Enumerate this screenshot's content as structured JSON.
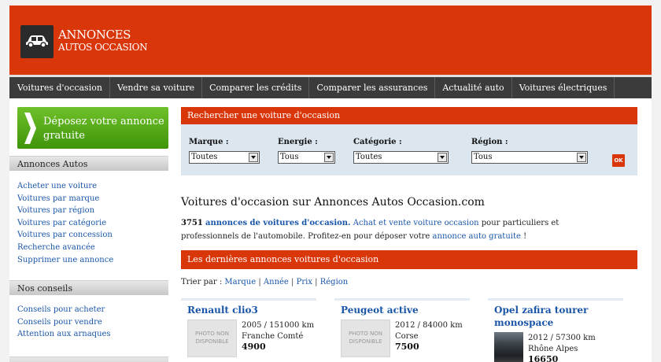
{
  "header": {
    "brand_line1": "ANNONCES",
    "brand_line2": "AUTOS OCCASION",
    "logo_icon": "car-icon"
  },
  "nav": {
    "items": [
      {
        "label": "Voitures d'occasion"
      },
      {
        "label": "Vendre sa voiture"
      },
      {
        "label": "Comparer les crédits"
      },
      {
        "label": "Comparer les assurances"
      },
      {
        "label": "Actualité auto"
      },
      {
        "label": "Voitures électriques"
      }
    ]
  },
  "sidebar": {
    "cta_line1": "Déposez votre annonce",
    "cta_line2": "gratuite",
    "cta_icon": "chevron-right-icon",
    "section1": {
      "title": "Annonces Autos",
      "links": [
        "Acheter une voiture",
        "Voitures par marque",
        "Voitures par région",
        "Voitures par catégorie",
        "Voitures par concession",
        "Recherche avancée",
        "Supprimer une annonce"
      ]
    },
    "section2": {
      "title": "Nos conseils",
      "links": [
        "Conseils pour acheter",
        "Conseils pour vendre",
        "Attention aux arnaques"
      ]
    }
  },
  "search": {
    "title": "Rechercher une voiture d'occasion",
    "marque_label": "Marque :",
    "marque_value": "Toutes",
    "energie_label": "Energie :",
    "energie_value": "Tous",
    "categorie_label": "Catégorie :",
    "categorie_value": "Toutes",
    "region_label": "Région :",
    "region_value": "Tous",
    "ok_label": "OK"
  },
  "main": {
    "title": "Voitures d'occasion sur Annonces Autos Occasion.com",
    "intro_count": "3751",
    "intro_link1": "annonces de voitures d'occasion.",
    "intro_link2": "Achat et vente voiture occasion",
    "intro_text1": "pour particuliers et professionnels de l'automobile. Profitez-en pour déposer votre",
    "intro_link3": "annonce auto gratuite",
    "intro_text2": "!",
    "ads_title": "Les dernières annonces voitures d'occasion",
    "sort_label": "Trier par :",
    "sort_options": [
      "Marque",
      "Année",
      "Prix",
      "Région"
    ]
  },
  "listings": [
    {
      "title": "Renault clio3",
      "photo_text": "PHOTO NON DISPONIBLE",
      "year_km": "2005 / 151000 km",
      "region": "Franche Comté",
      "price": "4900"
    },
    {
      "title": "Peugeot active",
      "photo_text": "PHOTO NON DISPONIBLE",
      "year_km": "2012 / 84000 km",
      "region": "Corse",
      "price": "7500"
    },
    {
      "title_line1": "Opel zafira tourer",
      "title_line2": "monospace",
      "year_km": "2012 / 57300 km",
      "region": "Rhône Alpes",
      "price": "16650"
    }
  ],
  "colors": {
    "brand_red": "#d9360a",
    "nav_dark": "#3b3b3b",
    "cta_green": "#5cae1c",
    "link_blue": "#1a56a8",
    "search_bg": "#dce6ef"
  }
}
